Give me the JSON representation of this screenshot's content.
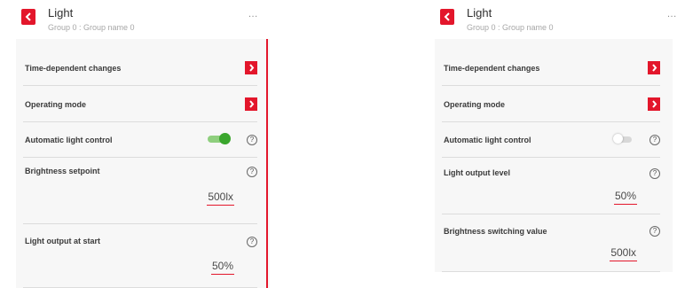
{
  "accent_color": "#e3162b",
  "toggle_on_color": "#3aa62d",
  "left": {
    "title": "Light",
    "subtitle": "Group 0 : Group name 0",
    "more": "...",
    "rows": {
      "time_dependent": "Time-dependent changes",
      "operating_mode": "Operating mode",
      "auto_light": "Automatic light control",
      "brightness_setpoint": "Brightness setpoint",
      "brightness_setpoint_value": "500lx",
      "light_output_start": "Light output at start",
      "light_output_start_value": "50%"
    },
    "auto_light_enabled": true
  },
  "right": {
    "title": "Light",
    "subtitle": "Group 0 : Group name 0",
    "more": "...",
    "rows": {
      "time_dependent": "Time-dependent changes",
      "operating_mode": "Operating mode",
      "auto_light": "Automatic light control",
      "light_output_level": "Light output level",
      "light_output_level_value": "50%",
      "brightness_switching": "Brightness switching value",
      "brightness_switching_value": "500lx"
    },
    "auto_light_enabled": false
  },
  "icons": {
    "back": "chevron-left-icon",
    "nav": "chevron-right-icon",
    "help": "help-circle-icon",
    "help_glyph": "?"
  }
}
